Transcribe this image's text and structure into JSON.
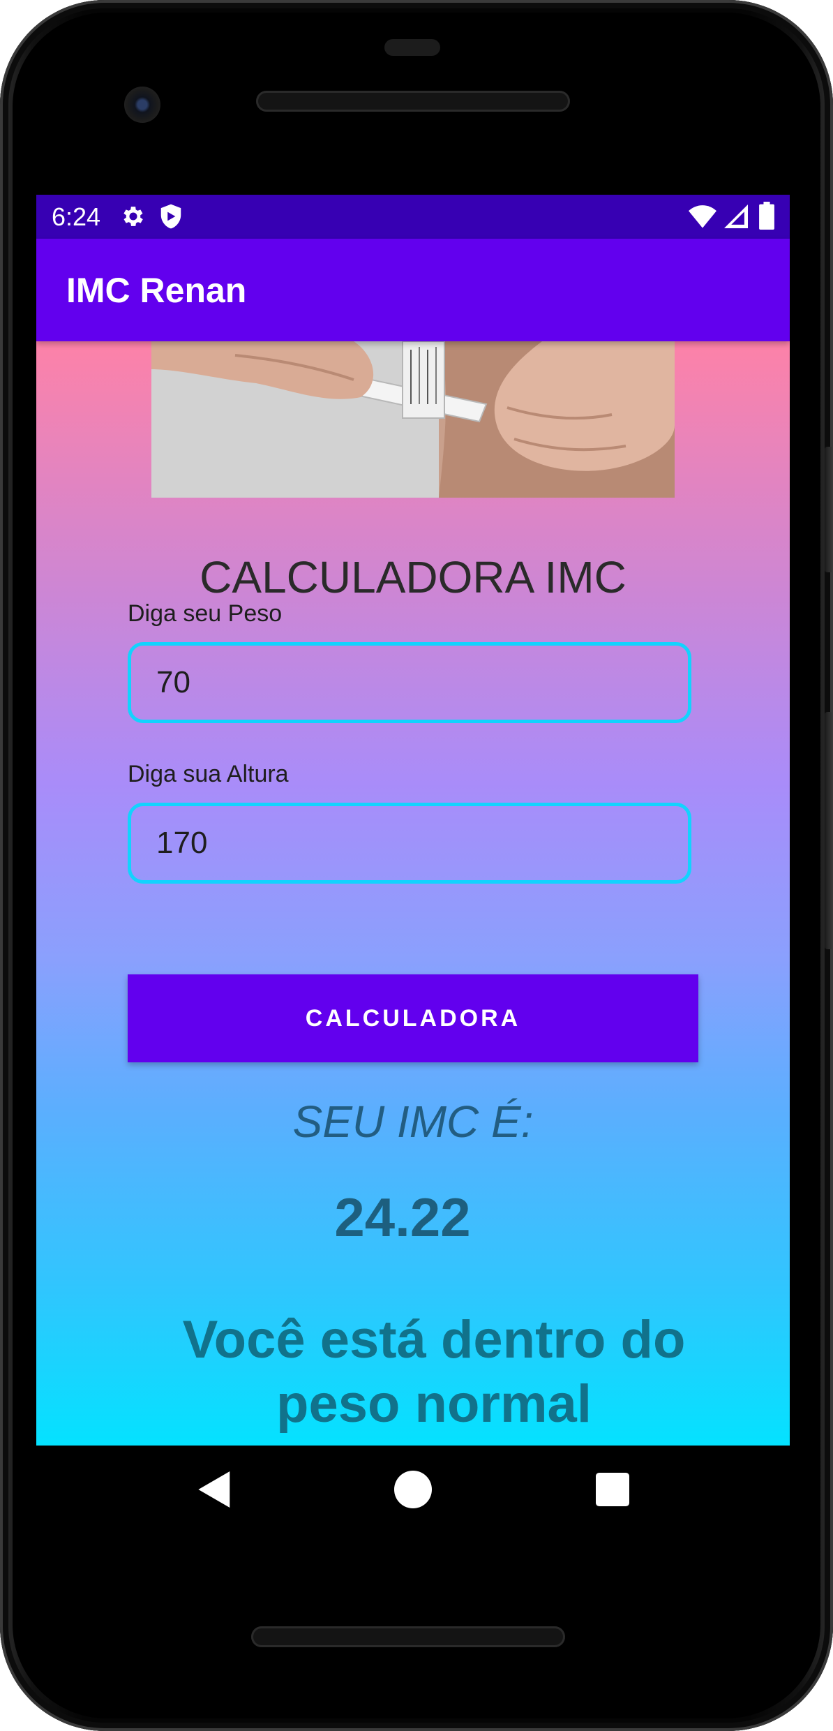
{
  "status_bar": {
    "time": "6:24",
    "icons": [
      "gear-icon",
      "shield-icon",
      "wifi-icon",
      "signal-icon",
      "battery-icon"
    ]
  },
  "app_bar": {
    "title": "IMC Renan"
  },
  "hero_image": {
    "icon": "caliper-measuring-photo"
  },
  "form": {
    "title": "CALCULADORA IMC",
    "weight_label": "Diga seu Peso",
    "weight_value": "70",
    "height_label": "Diga sua Altura",
    "height_value": "170",
    "button_label": "CALCULADORA"
  },
  "result": {
    "label": "SEU IMC É:",
    "value": "24.22",
    "message": "Você está dentro do peso normal"
  },
  "nav": {
    "icons": [
      "back-icon",
      "home-icon",
      "recents-icon"
    ]
  },
  "colors": {
    "status_bar": "#3700b3",
    "app_bar": "#6200ee",
    "accent": "#6200ee",
    "input_border": "#12d3fe",
    "gradient_top": "#fd82a8",
    "gradient_bottom": "#04e2ff"
  }
}
